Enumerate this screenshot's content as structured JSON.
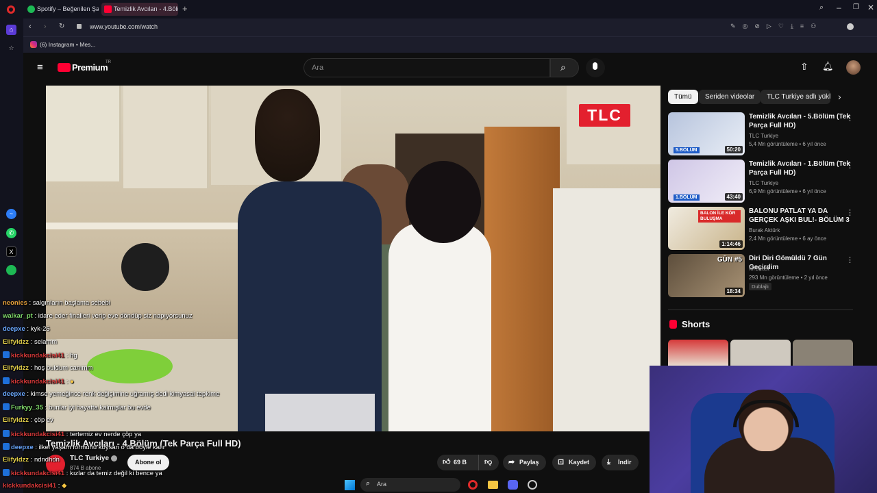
{
  "tabs": [
    {
      "label": "Spotify – Beğenilen Şarkıla",
      "active": false
    },
    {
      "label": "Temizlik Avcıları - 4.Bölüm",
      "active": true
    }
  ],
  "address": "www.youtube.com/watch",
  "bookmark": "(6) Instagram • Mes...",
  "yt": {
    "logo": "Premium",
    "region": "TR",
    "search_placeholder": "Ara"
  },
  "video": {
    "overlay_logo": "TLC",
    "title": "Temizlik Avcıları - 4.Bölüm (Tek Parça Full HD)",
    "channel": "TLC Turkiye",
    "subs": "874 B abone",
    "subscribe": "Abone ol",
    "likes": "69 B",
    "share": "Paylaş",
    "save": "Kaydet",
    "download": "İndir"
  },
  "chips": [
    "Tümü",
    "Seriden videolar",
    "TLC Turkiye adlı yükle"
  ],
  "recs": [
    {
      "title": "Temizlik Avcıları - 5.Bölüm (Tek Parça Full HD)",
      "channel": "TLC Turkiye",
      "meta": "5,4 Mn görüntüleme • 6 yıl önce",
      "duration": "50:20",
      "thumb_label": "5.BÖLÜM",
      "color": "#c8d3e8"
    },
    {
      "title": "Temizlik Avcıları - 1.Bölüm (Tek Parça Full HD)",
      "channel": "TLC Turkiye",
      "meta": "6,9 Mn görüntüleme • 6 yıl önce",
      "duration": "43:40",
      "thumb_label": "1.BÖLÜM",
      "color": "#d9d4ea"
    },
    {
      "title": "BALONU PATLAT YA DA GERÇEK AŞKI BUL!- BÖLÜM 3",
      "channel": "Burak Aktürk",
      "meta": "2,4 Mn görüntüleme • 6 ay önce",
      "duration": "1:14:46",
      "thumb_label": "BALON İLE KÖR BULUŞMA",
      "color": "#e8e2d4"
    },
    {
      "title": "Diri Diri Gömüldü 7 Gün Geçirdim",
      "channel": "MrBeast",
      "meta": "293 Mn görüntüleme • 2 yıl önce",
      "duration": "18:34",
      "thumb_label": "GÜN #5",
      "badge": "Dublajlı",
      "color": "#7c6a52"
    }
  ],
  "shorts_label": "Shorts",
  "chat": [
    {
      "user": "neonies",
      "msg": "salgınların başlama sebebi",
      "color": "#e8a23c",
      "badge": false
    },
    {
      "user": "walkar_pt",
      "msg": "idare eder finalleri verip eve döndüp siz napıyorsunuz",
      "color": "#7fd86a",
      "badge": false
    },
    {
      "user": "deepxe",
      "msg": "kyk-26",
      "color": "#6aa7ff",
      "badge": false
    },
    {
      "user": "Elifyldzz",
      "msg": "selamm",
      "color": "#e8d44c",
      "badge": false
    },
    {
      "user": "kickkundakcisi41",
      "msg": "hg",
      "color": "#d83a3a",
      "badge": true
    },
    {
      "user": "Elifyldzz",
      "msg": "hoş buldum canımm",
      "color": "#e8d44c",
      "badge": false
    },
    {
      "user": "kickkundakcisi41",
      "msg": "",
      "color": "#d83a3a",
      "badge": true
    },
    {
      "user": "deepxe",
      "msg": "kimse yemeğince renk değişimine uğramış dedi kimyasal tepkime",
      "color": "#6aa7ff",
      "badge": false
    },
    {
      "user": "Furkyy_35",
      "msg": "bunlar iyi hayatta kalmışlar bu evde",
      "color": "#7fd86a",
      "badge": true
    },
    {
      "user": "Elifyldzz",
      "msg": "çöp ev",
      "color": "#e8d44c",
      "badge": false
    },
    {
      "user": "kickkundakcisi41",
      "msg": "tertemiz ev nerde çöp ya",
      "color": "#d83a3a",
      "badge": true
    },
    {
      "user": "deepxe",
      "msg": "ilkel yaşam formunu koysan o da böyle kalır",
      "color": "#6aa7ff",
      "badge": true
    },
    {
      "user": "Elifyldzz",
      "msg": "ndndhdn",
      "color": "#e8d44c",
      "badge": false
    },
    {
      "user": "kickkundakcisi41",
      "msg": "kızlar da temiz değil ki bence ya",
      "color": "#d83a3a",
      "badge": true
    },
    {
      "user": "kickkundakcisi41",
      "msg": "",
      "color": "#d83a3a",
      "badge": false
    }
  ],
  "taskbar": {
    "search": "Ara"
  }
}
